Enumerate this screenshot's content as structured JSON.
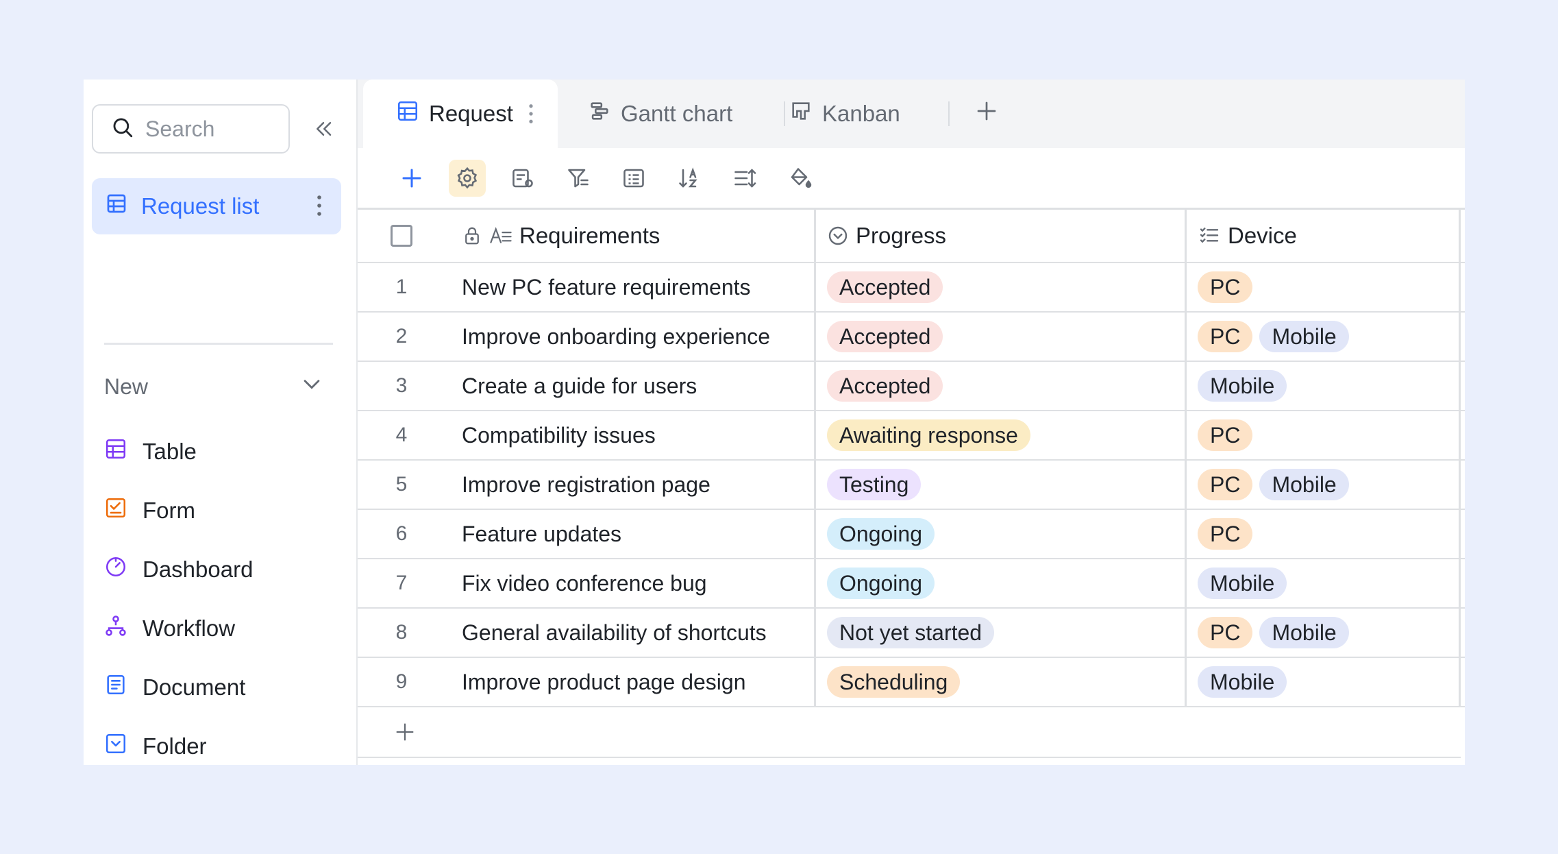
{
  "sidebar": {
    "search_placeholder": "Search",
    "active_item": "Request list",
    "new_label": "New",
    "create_items": [
      {
        "label": "Table",
        "icon": "table-icon",
        "color": "#7f3bf5"
      },
      {
        "label": "Form",
        "icon": "form-icon",
        "color": "#ed6d0c"
      },
      {
        "label": "Dashboard",
        "icon": "dashboard-icon",
        "color": "#7f3bf5"
      },
      {
        "label": "Workflow",
        "icon": "workflow-icon",
        "color": "#7f3bf5"
      },
      {
        "label": "Document",
        "icon": "document-icon",
        "color": "#3370ff"
      },
      {
        "label": "Folder",
        "icon": "folder-icon",
        "color": "#3370ff"
      }
    ]
  },
  "tabs": [
    {
      "label": "Request",
      "icon": "grid-icon"
    },
    {
      "label": "Gantt chart",
      "icon": "gantt-icon"
    },
    {
      "label": "Kanban",
      "icon": "kanban-icon"
    }
  ],
  "table": {
    "columns": {
      "requirements": "Requirements",
      "progress": "Progress",
      "device": "Device"
    },
    "rows": [
      {
        "idx": "1",
        "req": "New PC feature requirements",
        "progress": "Accepted",
        "devices": [
          "PC"
        ]
      },
      {
        "idx": "2",
        "req": "Improve onboarding experience",
        "progress": "Accepted",
        "devices": [
          "PC",
          "Mobile"
        ]
      },
      {
        "idx": "3",
        "req": "Create a guide for users",
        "progress": "Accepted",
        "devices": [
          "Mobile"
        ]
      },
      {
        "idx": "4",
        "req": "Compatibility issues",
        "progress": "Awaiting response",
        "devices": [
          "PC"
        ]
      },
      {
        "idx": "5",
        "req": "Improve registration page",
        "progress": "Testing",
        "devices": [
          "PC",
          "Mobile"
        ]
      },
      {
        "idx": "6",
        "req": "Feature updates",
        "progress": "Ongoing",
        "devices": [
          "PC"
        ]
      },
      {
        "idx": "7",
        "req": "Fix video conference bug",
        "progress": "Ongoing",
        "devices": [
          "Mobile"
        ]
      },
      {
        "idx": "8",
        "req": "General availability of shortcuts",
        "progress": "Not yet started",
        "devices": [
          "PC",
          "Mobile"
        ]
      },
      {
        "idx": "9",
        "req": "Improve product page design",
        "progress": "Scheduling",
        "devices": [
          "Mobile"
        ]
      }
    ]
  },
  "colors": {
    "accent": "#3370ff",
    "background": "#eaeffc",
    "status": {
      "Accepted": "#fbe2e0",
      "Awaiting response": "#fbecc4",
      "Testing": "#ece2fe",
      "Ongoing": "#d4eefb",
      "Not yet started": "#e4e8f4",
      "Scheduling": "#fde3c8"
    },
    "device": {
      "PC": "#fde3c8",
      "Mobile": "#e1e6f8"
    }
  }
}
